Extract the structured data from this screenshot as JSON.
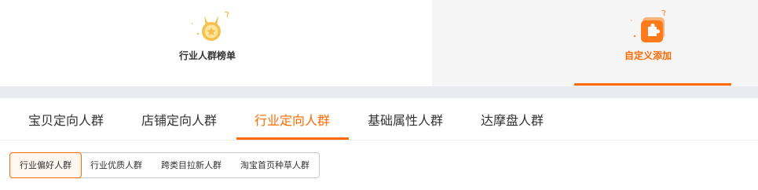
{
  "mode_selector": {
    "items": [
      {
        "label": "行业人群榜单",
        "icon": "medal-icon",
        "active": false
      },
      {
        "label": "自定义添加",
        "icon": "puzzle-card-icon",
        "active": true
      }
    ],
    "accent_color": "#ff6a00"
  },
  "audience_tabs": {
    "items": [
      {
        "label": "宝贝定向人群",
        "active": false
      },
      {
        "label": "店铺定向人群",
        "active": false
      },
      {
        "label": "行业定向人群",
        "active": true
      },
      {
        "label": "基础属性人群",
        "active": false
      },
      {
        "label": "达摩盘人群",
        "active": false
      }
    ]
  },
  "sub_tabs": {
    "items": [
      {
        "label": "行业偏好人群",
        "active": true
      },
      {
        "label": "行业优质人群",
        "active": false
      },
      {
        "label": "跨类目拉新人群",
        "active": false
      },
      {
        "label": "淘宝首页种草人群",
        "active": false
      }
    ]
  },
  "colors": {
    "accent": "#ff6a00",
    "medal_gold": "#f7c04a",
    "band": "#e9ebf0"
  }
}
